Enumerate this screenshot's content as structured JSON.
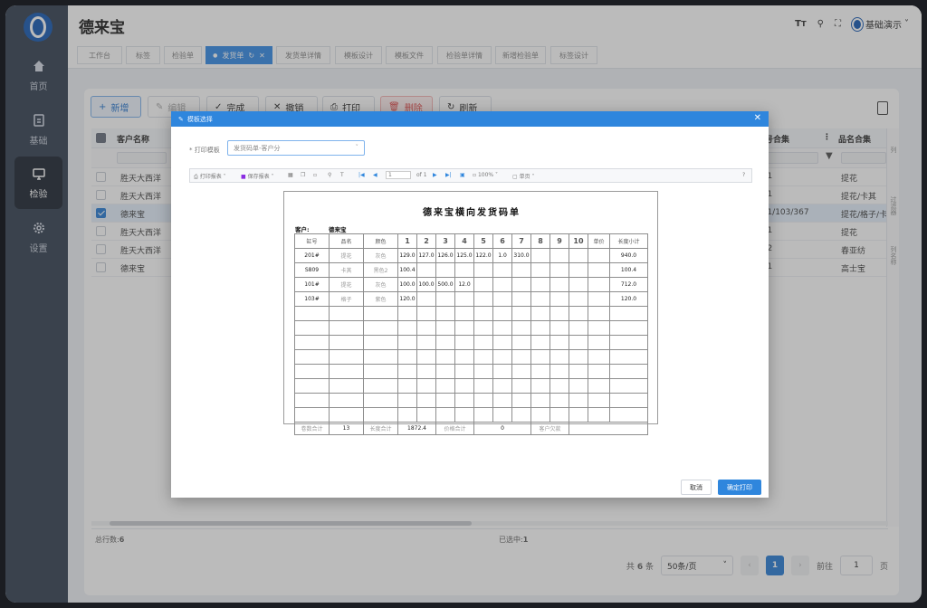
{
  "app": {
    "title": "德来宝"
  },
  "sidebar": {
    "items": [
      {
        "label": "首页",
        "icon": "home-icon"
      },
      {
        "label": "基础",
        "icon": "document-icon"
      },
      {
        "label": "检验",
        "icon": "monitor-icon",
        "active": true
      },
      {
        "label": "设置",
        "icon": "gear-icon"
      }
    ]
  },
  "header": {
    "user": "基础演示"
  },
  "tabs": [
    {
      "label": "工作台"
    },
    {
      "label": "标签"
    },
    {
      "label": "检验单"
    },
    {
      "label": "发货单",
      "active": true
    },
    {
      "label": "发货单详情"
    },
    {
      "label": "模板设计"
    },
    {
      "label": "模板文件"
    },
    {
      "label": "检验单详情"
    },
    {
      "label": "新增检验单"
    },
    {
      "label": "标签设计"
    }
  ],
  "toolbar": {
    "add": "新增",
    "edit": "编辑",
    "complete": "完成",
    "revoke": "撤销",
    "print": "打印",
    "delete": "删除",
    "refresh": "刷新"
  },
  "table": {
    "columns": {
      "customer": "客户名称",
      "vat_set": "缸号合集",
      "product_set": "品名合集"
    },
    "rows": [
      {
        "customer": "胜天大西洋",
        "vat": "101",
        "product": "提花"
      },
      {
        "customer": "胜天大西洋",
        "vat": "101",
        "product": "提花/卡其"
      },
      {
        "customer": "德来宝",
        "vat": "101/103/367",
        "product": "提花/格子/卡其",
        "checked": true
      },
      {
        "customer": "胜天大西洋",
        "vat": "101",
        "product": "提花"
      },
      {
        "customer": "胜天大西洋",
        "vat": "102",
        "product": "春亚纺"
      },
      {
        "customer": "德来宝",
        "vat": "801",
        "product": "高士宝"
      }
    ],
    "side_labels": [
      "列",
      "过滤器",
      "列名称"
    ]
  },
  "footer": {
    "total_label": "总行数:",
    "total_value": "6",
    "selected_label": "已选中:",
    "selected_value": "1"
  },
  "pager": {
    "total_prefix": "共",
    "total_count": "6",
    "total_suffix": "条",
    "page_size": "50条/页",
    "current_page": "1",
    "goto_label": "前往",
    "goto_value": "1",
    "goto_suffix": "页"
  },
  "dialog": {
    "title": "模板选择",
    "field_label": "* 打印模板",
    "template_value": "发货码单-客户分",
    "cancel": "取消",
    "confirm": "确定打印",
    "viewer": {
      "print_report": "打印报表",
      "save_report": "保存报表",
      "page_box": "1",
      "page_of": "of 1",
      "zoom": "100%",
      "single_page": "单页",
      "help": "?"
    }
  },
  "report": {
    "title": "德来宝横向发货码单",
    "customer_label": "客户:",
    "customer_value": "德来宝",
    "headers": [
      "缸号",
      "品名",
      "颜色",
      "1",
      "2",
      "3",
      "4",
      "5",
      "6",
      "7",
      "8",
      "9",
      "10",
      "单价",
      "长度小计"
    ],
    "rows": [
      [
        "201#",
        "提花",
        "灰色",
        "129.0",
        "127.0",
        "126.0",
        "125.0",
        "122.0",
        "1.0",
        "310.0",
        "",
        "",
        "",
        "",
        "940.0"
      ],
      [
        "S809",
        "卡其",
        "黑色2",
        "100.4",
        "",
        "",
        "",
        "",
        "",
        "",
        "",
        "",
        "",
        "",
        "100.4"
      ],
      [
        "101#",
        "提花",
        "灰色",
        "100.0",
        "100.0",
        "500.0",
        "12.0",
        "",
        "",
        "",
        "",
        "",
        "",
        "",
        "712.0"
      ],
      [
        "103#",
        "格子",
        "紫色",
        "120.0",
        "",
        "",
        "",
        "",
        "",
        "",
        "",
        "",
        "",
        "",
        "120.0"
      ]
    ],
    "empty_rows": 8,
    "footer": {
      "rolls_label": "卷数合计",
      "rolls_value": "13",
      "length_label": "长度合计",
      "length_value": "1872.4",
      "price_label": "价格合计",
      "price_value": "0",
      "debt_label": "客户欠款",
      "debt_value": ""
    }
  }
}
